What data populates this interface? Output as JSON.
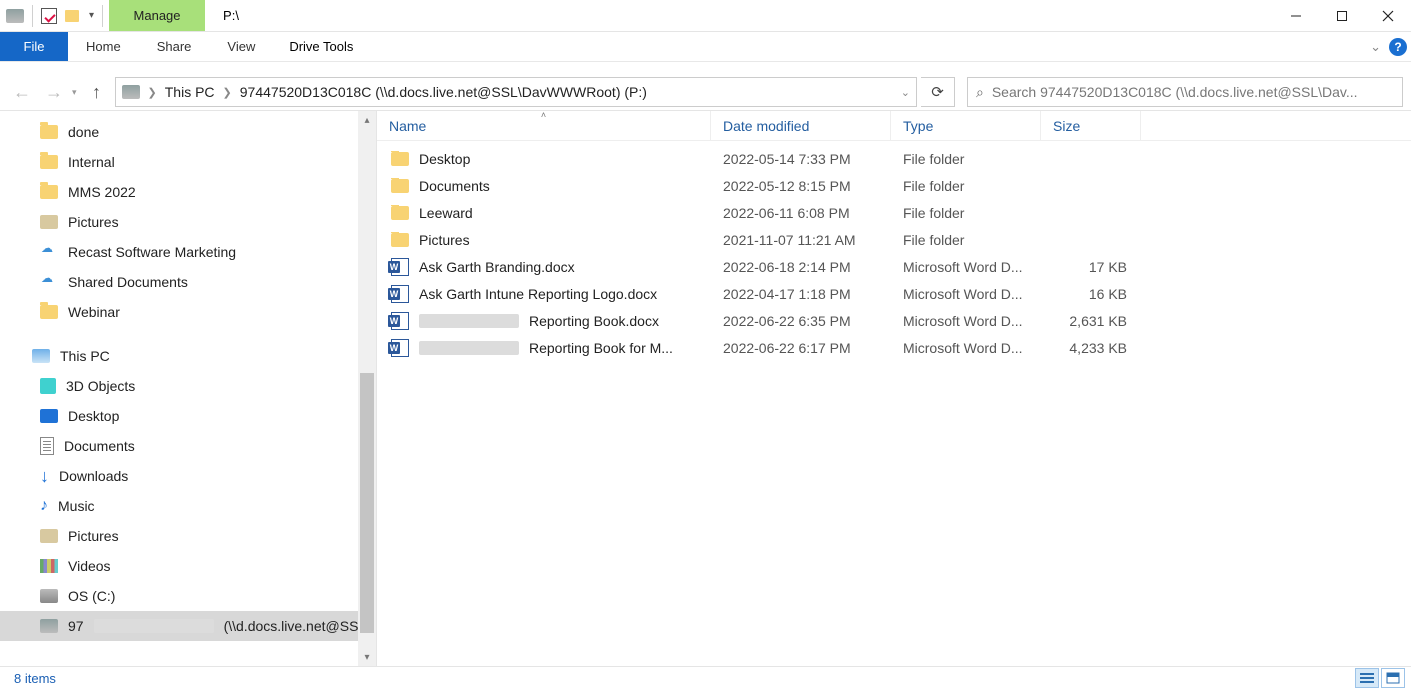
{
  "window": {
    "title": "P:\\",
    "contextTab": "Manage"
  },
  "ribbon": {
    "file": "File",
    "tabs": [
      "Home",
      "Share",
      "View"
    ],
    "contextTool": "Drive Tools"
  },
  "address": {
    "crumbs": [
      "This PC",
      "97447520D13C018C (\\\\d.docs.live.net@SSL\\DavWWWRoot) (P:)"
    ]
  },
  "search": {
    "placeholder": "Search 97447520D13C018C (\\\\d.docs.live.net@SSL\\Dav..."
  },
  "tree": {
    "quick": [
      {
        "label": "done",
        "icon": "folder"
      },
      {
        "label": "Internal",
        "icon": "folder"
      },
      {
        "label": "MMS 2022",
        "icon": "folder"
      },
      {
        "label": "Pictures",
        "icon": "lib"
      },
      {
        "label": "Recast Software Marketing",
        "icon": "cloud"
      },
      {
        "label": "Shared Documents",
        "icon": "cloud"
      },
      {
        "label": "Webinar",
        "icon": "folder"
      }
    ],
    "thispc_label": "This PC",
    "thispc": [
      {
        "label": "3D Objects",
        "icon": "3d"
      },
      {
        "label": "Desktop",
        "icon": "desktop"
      },
      {
        "label": "Documents",
        "icon": "doc"
      },
      {
        "label": "Downloads",
        "icon": "down"
      },
      {
        "label": "Music",
        "icon": "music"
      },
      {
        "label": "Pictures",
        "icon": "lib"
      },
      {
        "label": "Videos",
        "icon": "video"
      },
      {
        "label": "OS (C:)",
        "icon": "disk"
      }
    ],
    "selected_prefix": "97",
    "selected_suffix": "(\\\\d.docs.live.net@SSL\\"
  },
  "columns": {
    "name": "Name",
    "date": "Date modified",
    "type": "Type",
    "size": "Size"
  },
  "items": [
    {
      "kind": "folder",
      "name": "Desktop",
      "date": "2022-05-14 7:33 PM",
      "type": "File folder",
      "size": ""
    },
    {
      "kind": "folder",
      "name": "Documents",
      "date": "2022-05-12 8:15 PM",
      "type": "File folder",
      "size": ""
    },
    {
      "kind": "folder",
      "name": "Leeward",
      "date": "2022-06-11 6:08 PM",
      "type": "File folder",
      "size": ""
    },
    {
      "kind": "folder",
      "name": "Pictures",
      "date": "2021-11-07 11:21 AM",
      "type": "File folder",
      "size": ""
    },
    {
      "kind": "word",
      "name": "Ask Garth Branding.docx",
      "date": "2022-06-18 2:14 PM",
      "type": "Microsoft Word D...",
      "size": "17 KB"
    },
    {
      "kind": "word",
      "name": "Ask Garth Intune Reporting Logo.docx",
      "date": "2022-04-17 1:18 PM",
      "type": "Microsoft Word D...",
      "size": "16 KB"
    },
    {
      "kind": "word",
      "redactPre": true,
      "name": "Reporting Book.docx",
      "date": "2022-06-22 6:35 PM",
      "type": "Microsoft Word D...",
      "size": "2,631 KB"
    },
    {
      "kind": "word",
      "redactPre": true,
      "name": "Reporting Book for M...",
      "date": "2022-06-22 6:17 PM",
      "type": "Microsoft Word D...",
      "size": "4,233 KB"
    }
  ],
  "status": {
    "text": "8 items"
  }
}
